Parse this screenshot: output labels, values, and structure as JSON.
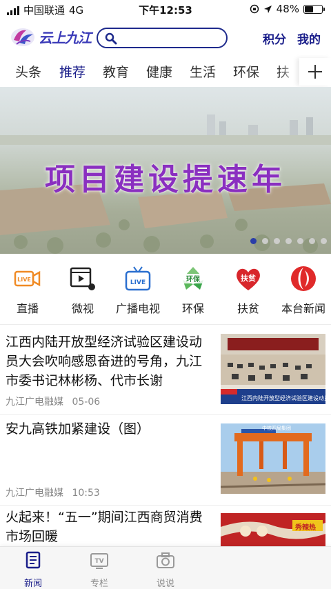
{
  "status_bar": {
    "carrier": "中国联通",
    "network": "4G",
    "time": "下午12:53",
    "battery": "48%",
    "battery_level": 0.48
  },
  "header": {
    "logo_text": "云上九江",
    "search_placeholder": "",
    "points_label": "积分",
    "mine_label": "我的"
  },
  "tabs": [
    {
      "label": "头条",
      "active": false
    },
    {
      "label": "推荐",
      "active": true
    },
    {
      "label": "教育",
      "active": false
    },
    {
      "label": "健康",
      "active": false
    },
    {
      "label": "生活",
      "active": false
    },
    {
      "label": "环保",
      "active": false
    },
    {
      "label": "扶",
      "active": false
    }
  ],
  "banner": {
    "title": "项目建设提速年",
    "slide_count": 7,
    "active_slide": 1
  },
  "categories": [
    {
      "label": "直播",
      "icon": "live-camera-icon",
      "badge": "LIVE"
    },
    {
      "label": "微视",
      "icon": "video-clip-icon"
    },
    {
      "label": "广播电视",
      "icon": "live-tv-icon",
      "badge": "LIVE"
    },
    {
      "label": "环保",
      "icon": "recycle-icon",
      "badge": "环保"
    },
    {
      "label": "扶贫",
      "icon": "poverty-heart-icon",
      "badge": "扶贫"
    },
    {
      "label": "本台新闻",
      "icon": "station-news-icon"
    }
  ],
  "news": [
    {
      "title": "江西内陆开放型经济试验区建设动员大会吹响感恩奋进的号角，九江市委书记林彬杨、代市长谢",
      "source": "九江广电融媒",
      "date": "05-06",
      "thumb_caption": "江西内陆开放型经济试验区建设动员大会召开"
    },
    {
      "title": "安九高铁加紧建设（图）",
      "source": "九江广电融媒",
      "date": "10:53",
      "thumb_caption": "中铁四局集团"
    },
    {
      "title": "火起来！“五一”期间江西商贸消费市场回暖",
      "source": "",
      "date": "",
      "thumb_caption": "秀辣热"
    }
  ],
  "bottom_nav": [
    {
      "label": "新闻",
      "icon": "news-doc-icon",
      "active": true
    },
    {
      "label": "专栏",
      "icon": "tv-icon",
      "active": false
    },
    {
      "label": "说说",
      "icon": "camera-icon",
      "active": false
    }
  ],
  "colors": {
    "brand": "#1a1e8a",
    "accent_purple": "#8a2fc0",
    "live_orange": "#f08a24",
    "green": "#3aa54a",
    "red": "#d8262b"
  }
}
